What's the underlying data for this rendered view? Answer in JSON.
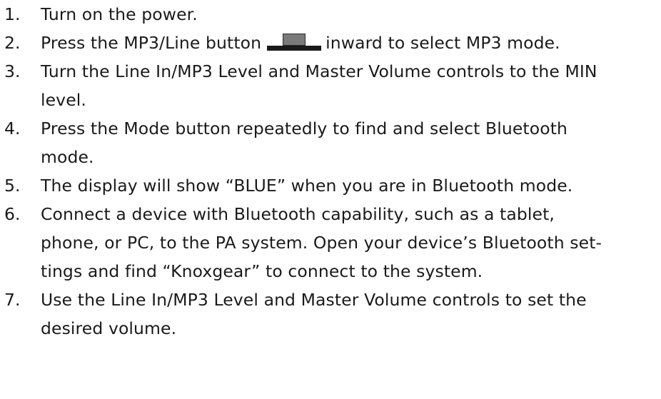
{
  "steps": [
    {
      "number": "1.",
      "text": "Turn on the power."
    },
    {
      "number": "2.",
      "text_before": "Press the MP3/Line button",
      "icon": "mp3-line-button-icon",
      "text_after": "inward to select MP3 mode."
    },
    {
      "number": "3.",
      "line1": "Turn the Line In/MP3 Level and Master Volume controls to the MIN",
      "line2": "level."
    },
    {
      "number": "4.",
      "line1": "Press the Mode button repeatedly to find and select Bluetooth",
      "line2": "mode."
    },
    {
      "number": "5.",
      "text": "The display will show “BLUE” when you are in Bluetooth mode."
    },
    {
      "number": "6.",
      "line1": "Connect a device with Bluetooth capability, such as a tablet,",
      "line2": "phone, or PC, to the PA system. Open your device’s Bluetooth set-",
      "line3": "tings and find “Knoxgear” to connect to the system."
    },
    {
      "number": "7.",
      "line1": "Use the Line In/MP3 Level and Master Volume controls to set the",
      "line2": "desired volume."
    }
  ]
}
